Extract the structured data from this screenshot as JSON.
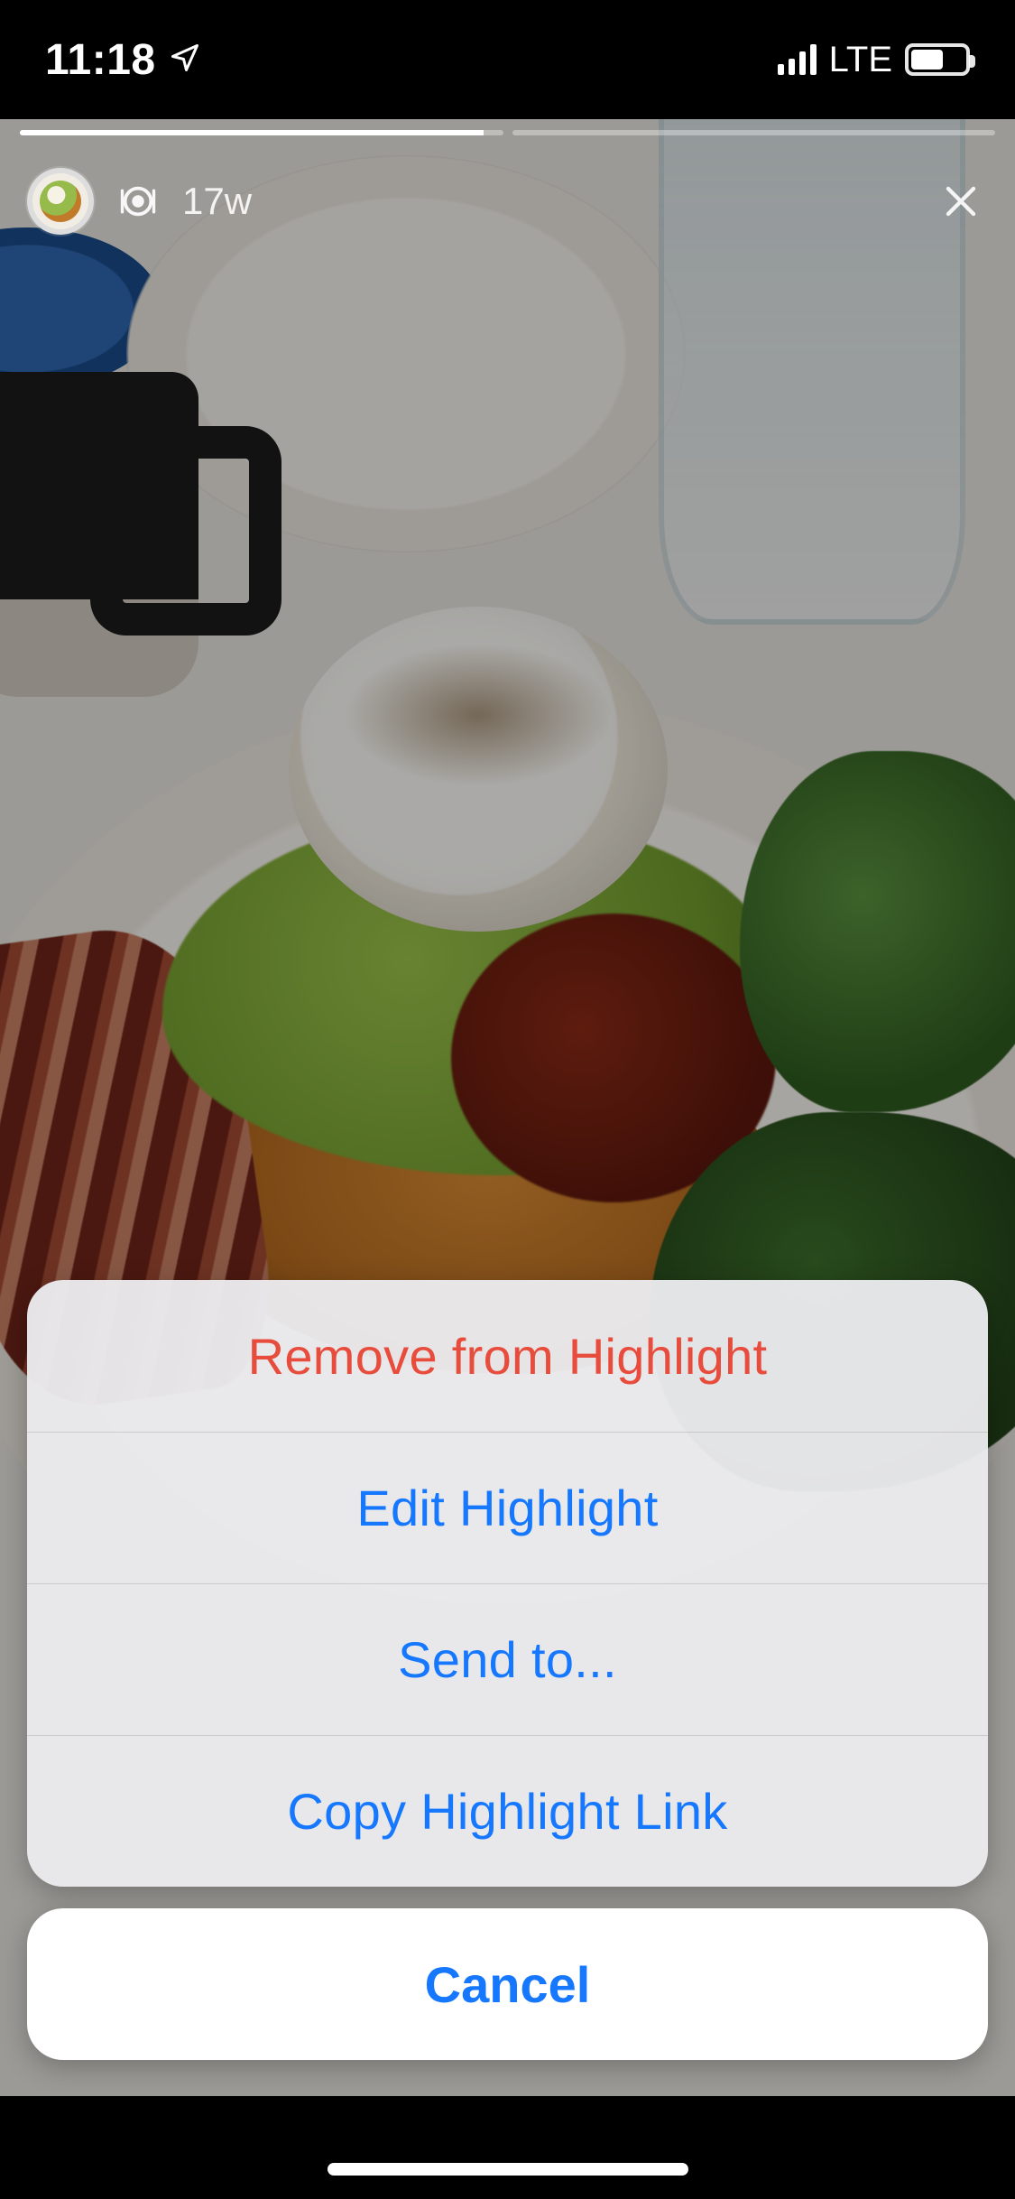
{
  "status_bar": {
    "time": "11:18",
    "network_type": "LTE"
  },
  "story": {
    "progress_segments": 2,
    "progress_fill_pct": [
      96,
      0
    ],
    "timestamp": "17w"
  },
  "action_sheet": {
    "items": [
      {
        "label": "Remove from Highlight",
        "style": "destructive"
      },
      {
        "label": "Edit Highlight",
        "style": "default"
      },
      {
        "label": "Send to...",
        "style": "default"
      },
      {
        "label": "Copy Highlight Link",
        "style": "default"
      }
    ],
    "cancel_label": "Cancel"
  },
  "colors": {
    "ios_blue": "#1677ff",
    "ios_red": "#e74c3c",
    "sheet_bg": "rgba(235,235,238,0.96)"
  }
}
